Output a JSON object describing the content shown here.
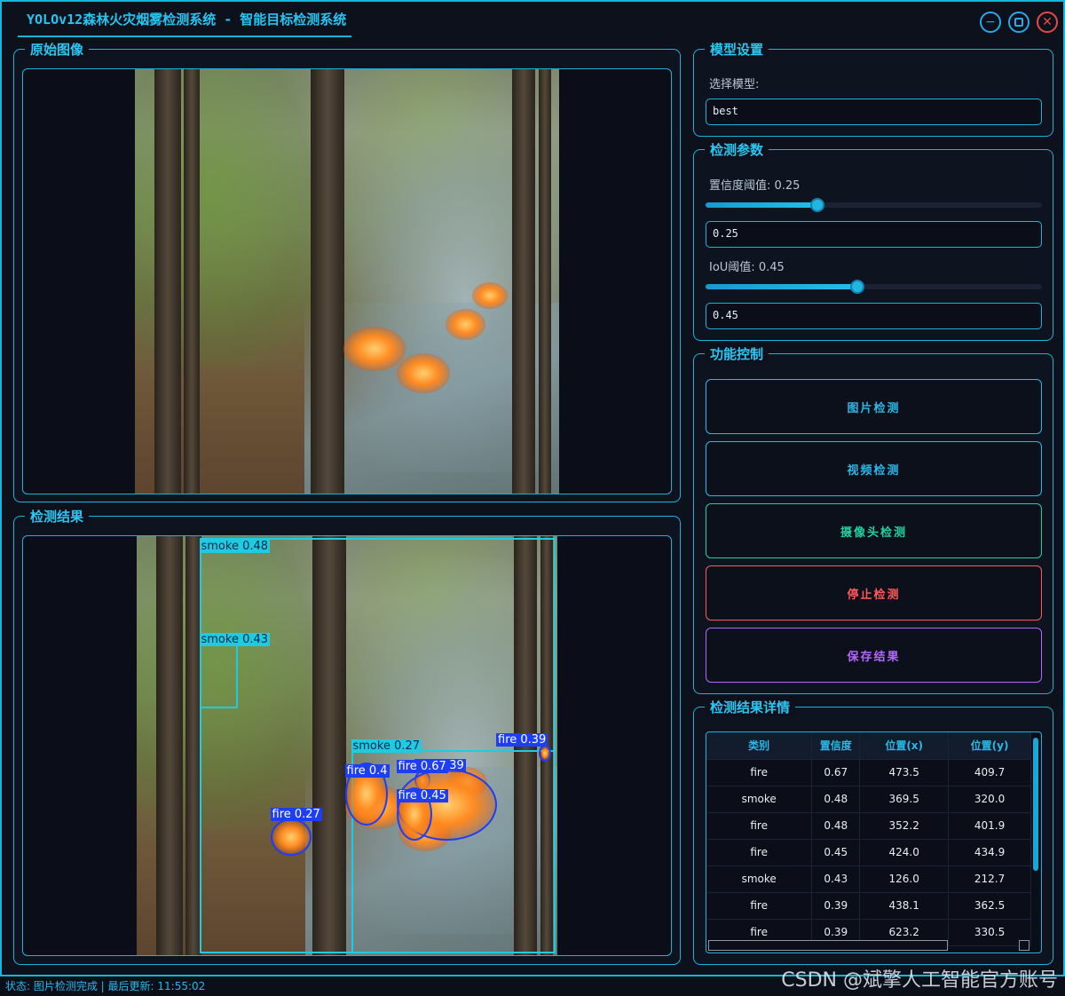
{
  "window": {
    "title": "YOLOv12森林火灾烟雾检测系统 - 智能目标检测系统"
  },
  "original_panel": {
    "title": "原始图像"
  },
  "result_panel": {
    "title": "检测结果",
    "detections": [
      {
        "cls": "smoke",
        "label": "smoke 0.48"
      },
      {
        "cls": "smoke",
        "label": "smoke 0.43"
      },
      {
        "cls": "smoke",
        "label": "smoke 0.27"
      },
      {
        "cls": "fire",
        "label": "fire 0.39"
      },
      {
        "cls": "fire",
        "label": "fire 0.39"
      },
      {
        "cls": "fire",
        "label": "fire 0.4"
      },
      {
        "cls": "fire",
        "label": "fire 0.67"
      },
      {
        "cls": "fire",
        "label": "fire 0.45"
      },
      {
        "cls": "fire",
        "label": "fire 0.27"
      }
    ]
  },
  "model_settings": {
    "title": "模型设置",
    "select_label": "选择模型:",
    "model_value": "best"
  },
  "params": {
    "title": "检测参数",
    "conf_label": "置信度阈值: 0.25",
    "conf_value": "0.25",
    "conf": 0.25,
    "iou_label": "IoU阈值: 0.45",
    "iou_value": "0.45",
    "iou": 0.45
  },
  "controls": {
    "title": "功能控制",
    "buttons": [
      {
        "label": "图片检测",
        "color": "#2ab8e8"
      },
      {
        "label": "视频检测",
        "color": "#2ab8e8"
      },
      {
        "label": "摄像头检测",
        "color": "#23d0a0"
      },
      {
        "label": "停止检测",
        "color": "#ff5a5a"
      },
      {
        "label": "保存结果",
        "color": "#b466ff"
      }
    ]
  },
  "details": {
    "title": "检测结果详情",
    "headers": [
      "类别",
      "置信度",
      "位置(x)",
      "位置(y)"
    ],
    "rows": [
      [
        "fire",
        "0.67",
        "473.5",
        "409.7"
      ],
      [
        "smoke",
        "0.48",
        "369.5",
        "320.0"
      ],
      [
        "fire",
        "0.48",
        "352.2",
        "401.9"
      ],
      [
        "fire",
        "0.45",
        "424.0",
        "434.9"
      ],
      [
        "smoke",
        "0.43",
        "126.0",
        "212.7"
      ],
      [
        "fire",
        "0.39",
        "438.1",
        "362.5"
      ],
      [
        "fire",
        "0.39",
        "623.2",
        "330.5"
      ]
    ]
  },
  "status": {
    "text": "状态: 图片检测完成 | 最后更新: 11:55:02"
  },
  "watermark": "CSDN @斌擎人工智能官方账号"
}
